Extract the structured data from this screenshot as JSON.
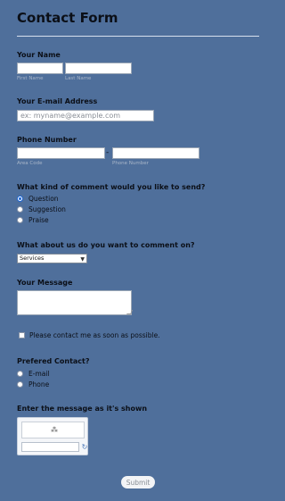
{
  "form": {
    "title": "Contact Form",
    "name": {
      "label": "Your Name",
      "first_sub": "First Name",
      "last_sub": "Last Name",
      "first_value": "",
      "last_value": ""
    },
    "email": {
      "label": "Your E-mail Address",
      "placeholder": "ex: myname@example.com",
      "value": ""
    },
    "phone": {
      "label": "Phone Number",
      "area_sub": "Area Code",
      "number_sub": "Phone Number",
      "dash": "-"
    },
    "comment_kind": {
      "label": "What kind of comment would you like to send?",
      "options": [
        "Question",
        "Suggestion",
        "Praise"
      ],
      "selected": "Question"
    },
    "about": {
      "label": "What about us do you want to comment on?",
      "selected": "Services"
    },
    "message": {
      "label": "Your Message",
      "value": ""
    },
    "contact_asap": {
      "label": "Please contact me as soon as possible.",
      "checked": false
    },
    "preferred": {
      "label": "Prefered Contact?",
      "options": [
        "E-mail",
        "Phone"
      ],
      "selected": ""
    },
    "captcha": {
      "label": "Enter the message as it's shown",
      "refresh_icon": "refresh-icon",
      "loading_icon": "loading-spinner-icon"
    },
    "submit_label": "Submit"
  },
  "colors": {
    "background": "#4f6f9b",
    "radio_accent": "#1e68d6"
  }
}
